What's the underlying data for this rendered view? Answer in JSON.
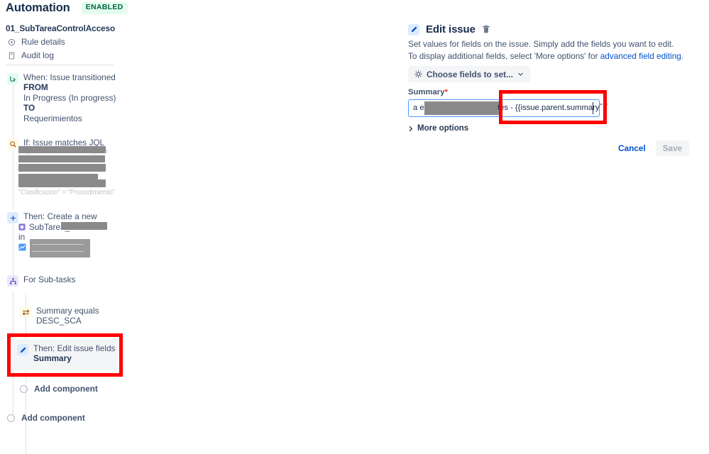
{
  "sidebar": {
    "title": "Automation",
    "status_badge": "ENABLED",
    "rule_name": "01_SubTareaControlAcceso",
    "nav": [
      {
        "label": "Rule details",
        "icon": "info-circle-icon"
      },
      {
        "label": "Audit log",
        "icon": "audit-log-icon"
      }
    ],
    "components": [
      {
        "id": "trigger",
        "icon": "trigger-icon",
        "title": "When: Issue transitioned",
        "detail_lines": [
          "FROM",
          "In Progress (In progress)",
          "TO",
          "Requerimientos"
        ]
      },
      {
        "id": "condition-jql",
        "icon": "jql-search-icon",
        "title": "If: Issue matches JQL",
        "detail_redacted": true,
        "visible_fragments": [
          "ta",
          "ON"
        ]
      },
      {
        "id": "action-create",
        "icon": "plus-icon",
        "title": "Then: Create a new",
        "subtype_label": "SubTarea_",
        "subtype_icon": "subtask-icon",
        "in_label": "in",
        "project_icon": "project-icon",
        "project_redacted": true
      },
      {
        "id": "branch-subtasks",
        "icon": "branch-icon",
        "title": "For Sub-tasks"
      },
      {
        "id": "condition-summary",
        "icon": "compare-icon",
        "title": "Summary equals",
        "detail_lines": [
          "DESC_SCA"
        ]
      },
      {
        "id": "action-edit",
        "icon": "pencil-icon",
        "title": "Then: Edit issue fields",
        "detail_bold": "Summary",
        "selected": true,
        "highlighted": true
      }
    ],
    "add_component_inner": "Add component",
    "add_component_outer": "Add component"
  },
  "detail": {
    "icon": "pencil-icon",
    "title": "Edit issue",
    "delete_icon": "trash-icon",
    "description_line1": "Set values for fields on the issue. Simply add the fields you want to edit.",
    "description_line2_prefix": "To display additional fields, select 'More options' for ",
    "description_line2_link": "advanced field editing",
    "description_line2_suffix": ".",
    "choose_fields_label": "Choose fields to set...",
    "choose_fields_icon": "gear-icon",
    "choose_fields_chevron": "chevron-down-icon",
    "summary_field": {
      "label": "Summary",
      "required_marker": "*",
      "value_prefix": "a eq",
      "value_redacted": true,
      "value_mid": "tes",
      "value_smart_value": " - {{issue.parent.summary}}",
      "has_caret": true
    },
    "more_options_label": "More options",
    "more_options_icon": "chevron-right-icon",
    "cancel_label": "Cancel",
    "save_label": "Save",
    "save_disabled": true
  },
  "annotations": {
    "highlight_color": "#ff0000",
    "boxes": [
      {
        "target": "action-edit-component",
        "color": "#ff0000"
      },
      {
        "target": "summary-smart-value",
        "color": "#ff0000"
      }
    ]
  },
  "colors": {
    "text_primary": "#172b4d",
    "text_secondary": "#42526e",
    "link": "#0052cc",
    "badge_bg": "#e3fcef",
    "badge_text": "#006644",
    "required": "#de350b",
    "input_border": "#4c9aff",
    "selected_bg": "#f4f5f7"
  }
}
